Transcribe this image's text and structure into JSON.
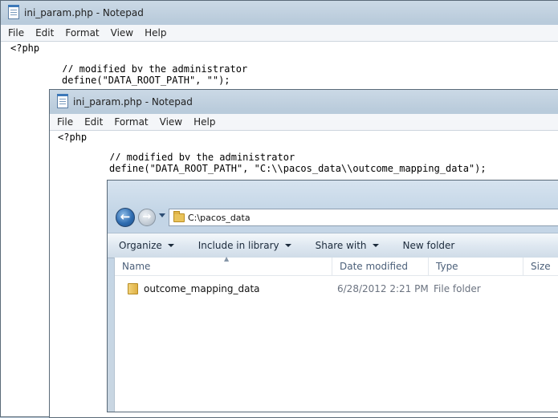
{
  "notepad_back": {
    "title": "ini_param.php - Notepad",
    "menu": [
      "File",
      "Edit",
      "Format",
      "View",
      "Help"
    ],
    "code": {
      "line1": "<?php",
      "line2": "// modified by the administrator",
      "line3": "define(\"DATA_ROOT_PATH\", \"\");"
    }
  },
  "notepad_front": {
    "title": "ini_param.php - Notepad",
    "menu": [
      "File",
      "Edit",
      "Format",
      "View",
      "Help"
    ],
    "code": {
      "line1": "<?php",
      "line2": "// modified by the administrator",
      "line3": "define(\"DATA_ROOT_PATH\", \"C:\\\\pacos_data\\\\outcome_mapping_data\");"
    }
  },
  "explorer": {
    "address": "C:\\pacos_data",
    "commands": [
      "Organize",
      "Include in library",
      "Share with",
      "New folder"
    ],
    "columns": [
      "Name",
      "Date modified",
      "Type",
      "Size"
    ],
    "rows": [
      {
        "name": "outcome_mapping_data",
        "date": "6/28/2012 2:21 PM",
        "type": "File folder",
        "size": ""
      }
    ]
  },
  "icons": {
    "notepad": "notepad-icon",
    "back": "back-arrow-icon",
    "forward": "forward-arrow-icon",
    "folder": "folder-icon"
  }
}
